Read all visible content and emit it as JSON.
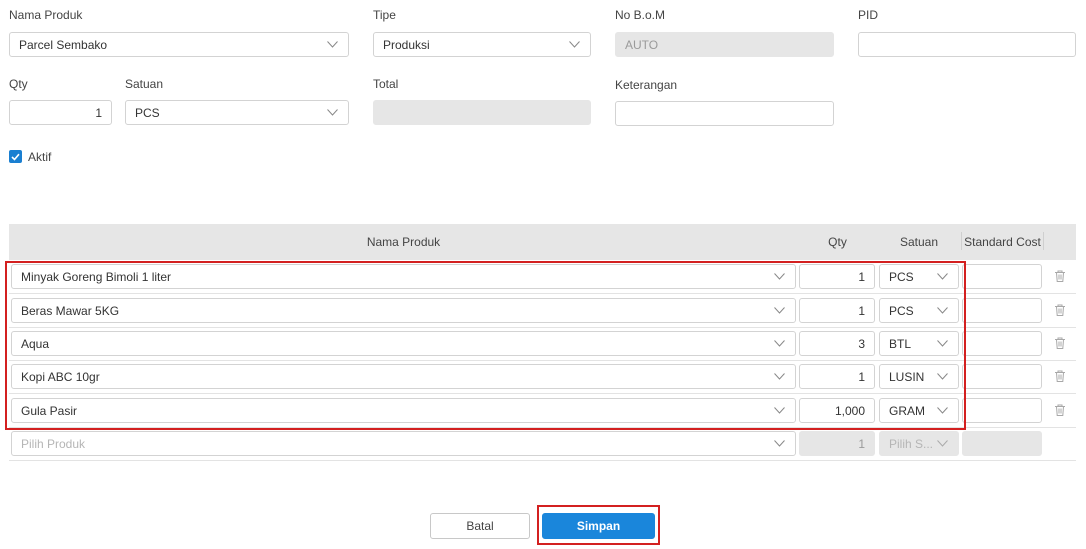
{
  "form": {
    "nama_produk_label": "Nama Produk",
    "nama_produk_value": "Parcel Sembako",
    "tipe_label": "Tipe",
    "tipe_value": "Produksi",
    "no_bom_label": "No B.o.M",
    "no_bom_value": "AUTO",
    "pid_label": "PID",
    "pid_value": "",
    "qty_label": "Qty",
    "qty_value": "1",
    "satuan_label": "Satuan",
    "satuan_value": "PCS",
    "total_label": "Total",
    "total_value": "",
    "keterangan_label": "Keterangan",
    "keterangan_value": "",
    "aktif_label": "Aktif"
  },
  "table": {
    "headers": {
      "nama_produk": "Nama Produk",
      "qty": "Qty",
      "satuan": "Satuan",
      "standard_cost": "Standard Cost"
    },
    "rows": [
      {
        "produk": "Minyak Goreng Bimoli 1 liter",
        "qty": "1",
        "satuan": "PCS",
        "cost": ""
      },
      {
        "produk": "Beras Mawar 5KG",
        "qty": "1",
        "satuan": "PCS",
        "cost": ""
      },
      {
        "produk": "Aqua",
        "qty": "3",
        "satuan": "BTL",
        "cost": ""
      },
      {
        "produk": "Kopi ABC 10gr",
        "qty": "1",
        "satuan": "LUSIN",
        "cost": ""
      },
      {
        "produk": "Gula Pasir",
        "qty": "1,000",
        "satuan": "GRAM",
        "cost": ""
      }
    ],
    "new_row": {
      "produk_placeholder": "Pilih Produk",
      "qty": "1",
      "satuan_placeholder": "Pilih S..."
    }
  },
  "buttons": {
    "batal": "Batal",
    "simpan": "Simpan"
  },
  "colors": {
    "primary": "#1a86db",
    "highlight": "#d32020",
    "disabled": "#e6e6e6"
  },
  "icons": {
    "dropdown": "chevron-down-icon",
    "delete": "trash-icon",
    "checkbox": "check-icon"
  }
}
